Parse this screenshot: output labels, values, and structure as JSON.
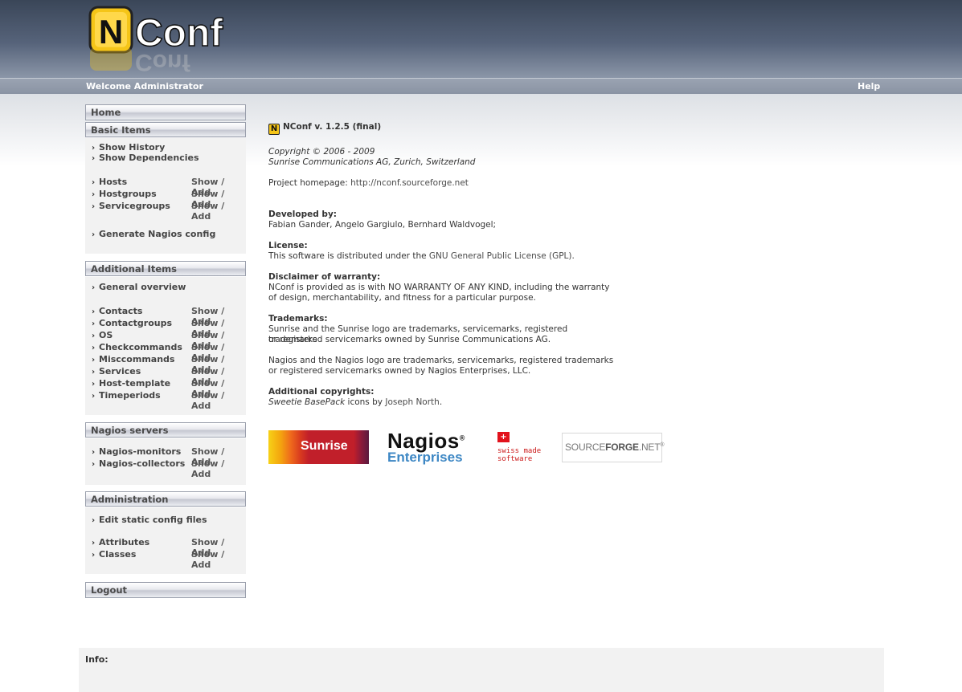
{
  "header": {
    "logo_text": "NConf",
    "welcome": "Welcome Administrator",
    "help": "Help"
  },
  "nav": {
    "home": "Home",
    "show_add": "Show / Add",
    "basic": {
      "title": "Basic Items",
      "links": [
        "Show History",
        "Show Dependencies"
      ],
      "items": [
        "Hosts",
        "Hostgroups",
        "Servicegroups"
      ],
      "generate": "Generate Nagios config"
    },
    "additional": {
      "title": "Additional Items",
      "overview": "General overview",
      "items": [
        "Contacts",
        "Contactgroups",
        "OS",
        "Checkcommands",
        "Misccommands",
        "Services",
        "Host-template",
        "Timeperiods"
      ]
    },
    "nagios_servers": {
      "title": "Nagios servers",
      "items": [
        "Nagios-monitors",
        "Nagios-collectors"
      ]
    },
    "administration": {
      "title": "Administration",
      "edit": "Edit static config files",
      "items": [
        "Attributes",
        "Classes"
      ]
    },
    "logout": "Logout"
  },
  "content": {
    "version": "NConf v. 1.2.5 (final)",
    "copyright_1": "Copyright © 2006 - 2009",
    "copyright_2": "Sunrise Communications AG, Zurich, Switzerland",
    "homepage_label": "Project homepage: ",
    "homepage_url": "http://nconf.sourceforge.net",
    "developed_title": "Developed by:",
    "developed_text": "Fabian Gander, Angelo Gargiulo, Bernhard Waldvogel;",
    "license_title": "License:",
    "license_pre": "This software is distributed under the ",
    "license_link": "GNU General Public License (GPL)",
    "license_post": ".",
    "disclaimer_title": "Disclaimer of warranty:",
    "disclaimer_1": "NConf is provided as is with NO WARRANTY OF ANY KIND, including the warranty",
    "disclaimer_2": "of design, merchantability, and fitness for a particular purpose.",
    "trademarks_title": "Trademarks:",
    "trademarks_1": "Sunrise and the Sunrise logo are trademarks, servicemarks, registered trademarks",
    "trademarks_2": "or registered servicemarks owned by Sunrise Communications AG.",
    "nagios_tm_1": "Nagios and the Nagios logo are trademarks, servicemarks, registered trademarks",
    "nagios_tm_2": "or registered servicemarks owned by Nagios Enterprises, LLC.",
    "addcopy_title": "Additional copyrights:",
    "addcopy_ital": "Sweetie BasePack",
    "addcopy_mid": " icons by ",
    "addcopy_link": "Joseph North",
    "addcopy_end": "."
  },
  "partners": {
    "sunrise": "Sunrise",
    "nagios_1": "Nagios",
    "nagios_reg": "®",
    "nagios_2": "Enterprises",
    "swiss_1": "swiss made",
    "swiss_2": "software",
    "swiss_flag": "+",
    "sf_1": "SOURCE",
    "sf_2": "FORGE",
    "sf_3": ".NET",
    "sf_reg": "®"
  },
  "info": {
    "label": "Info:"
  },
  "colors": {
    "header_dark": "#3a4658",
    "topbar": "#9aa3b2",
    "nagios_blue": "#3d87c4",
    "sunrise_red": "#c11f2a"
  }
}
